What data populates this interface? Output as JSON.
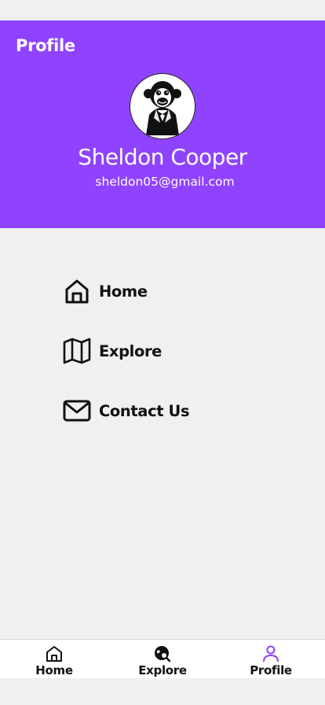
{
  "header": {
    "title": "Profile",
    "name": "Sheldon Cooper",
    "email": "sheldon05@gmail.com",
    "avatar_icon": "monkey-in-suit-avatar"
  },
  "menu": {
    "items": [
      {
        "label": "Home",
        "icon": "home-icon"
      },
      {
        "label": "Explore",
        "icon": "map-icon"
      },
      {
        "label": "Contact Us",
        "icon": "mail-icon"
      }
    ]
  },
  "tabbar": {
    "active": "Profile",
    "items": [
      {
        "label": "Home",
        "icon": "home-icon"
      },
      {
        "label": "Explore",
        "icon": "explore-globe-icon"
      },
      {
        "label": "Profile",
        "icon": "person-icon"
      }
    ]
  },
  "colors": {
    "header_bg": "#8f43fe",
    "page_bg": "#f0f0f0",
    "active_tab_icon": "#8f43fe"
  }
}
